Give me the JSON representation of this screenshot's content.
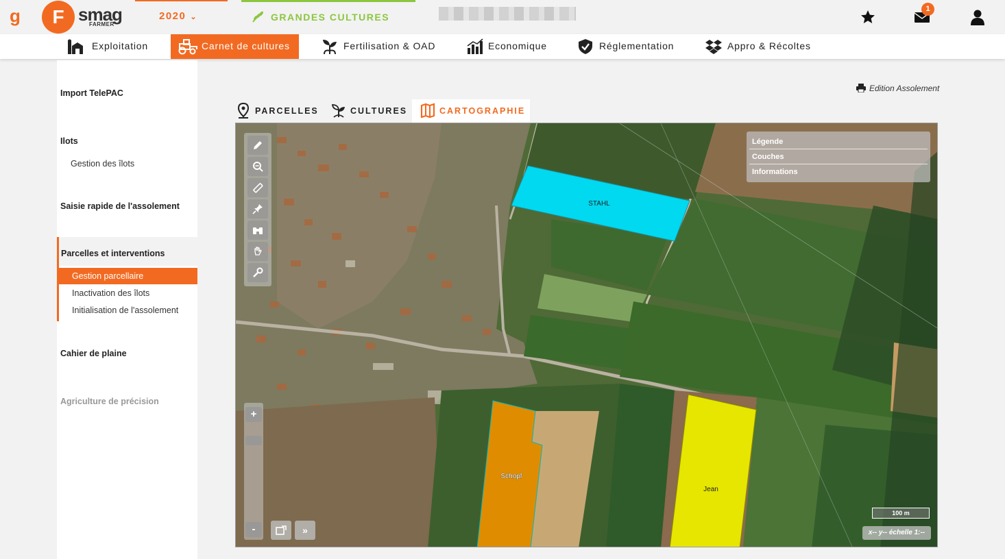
{
  "header": {
    "brand_letter": "g",
    "logo_letter": "F",
    "logo_word": "smag",
    "logo_sub": "FARMER",
    "year": "2020",
    "activity": "GRANDES CULTURES",
    "notifications_count": "1",
    "colors": {
      "brand": "#f26a21",
      "activity": "#8cc63f"
    }
  },
  "nav": {
    "items": [
      {
        "label": "Exploitation",
        "icon": "farm-icon"
      },
      {
        "label": "Carnet de cultures",
        "icon": "tractor-icon",
        "active": true
      },
      {
        "label": "Fertilisation & OAD",
        "icon": "plant-icon"
      },
      {
        "label": "Economique",
        "icon": "bar-chart-icon"
      },
      {
        "label": "Réglementation",
        "icon": "shield-check-icon"
      },
      {
        "label": "Appro & Récoltes",
        "icon": "dropbox-icon"
      }
    ]
  },
  "sidebar": {
    "import": "Import TelePAC",
    "ilots": "Ilots",
    "ilots_sub": "Gestion des îlots",
    "saisie": "Saisie rapide de l'assolement",
    "parcelles": "Parcelles et interventions",
    "parcelles_items": [
      "Gestion parcellaire",
      "Inactivation des îlots",
      "Initialisation de l'assolement"
    ],
    "cahier": "Cahier de plaine",
    "agriculture": "Agriculture de précision"
  },
  "content": {
    "edition": "Edition Assolement",
    "tabs": [
      {
        "label": "PARCELLES",
        "icon": "map-pin-icon"
      },
      {
        "label": "CULTURES",
        "icon": "seedling-icon"
      },
      {
        "label": "CARTOGRAPHIE",
        "icon": "map-icon",
        "active": true
      }
    ]
  },
  "map": {
    "legend": [
      "Légende",
      "Couches",
      "Informations"
    ],
    "parcels": [
      {
        "name": "STAHL",
        "color": "#00d9f0"
      },
      {
        "name": "Schopf",
        "color": "#e08c00"
      },
      {
        "name": "Jean",
        "color": "#e6e600"
      }
    ],
    "zoom_in": "+",
    "zoom_out": "-",
    "next": "»",
    "scale": "100 m",
    "coords": "x-- y-- échelle 1:--"
  }
}
